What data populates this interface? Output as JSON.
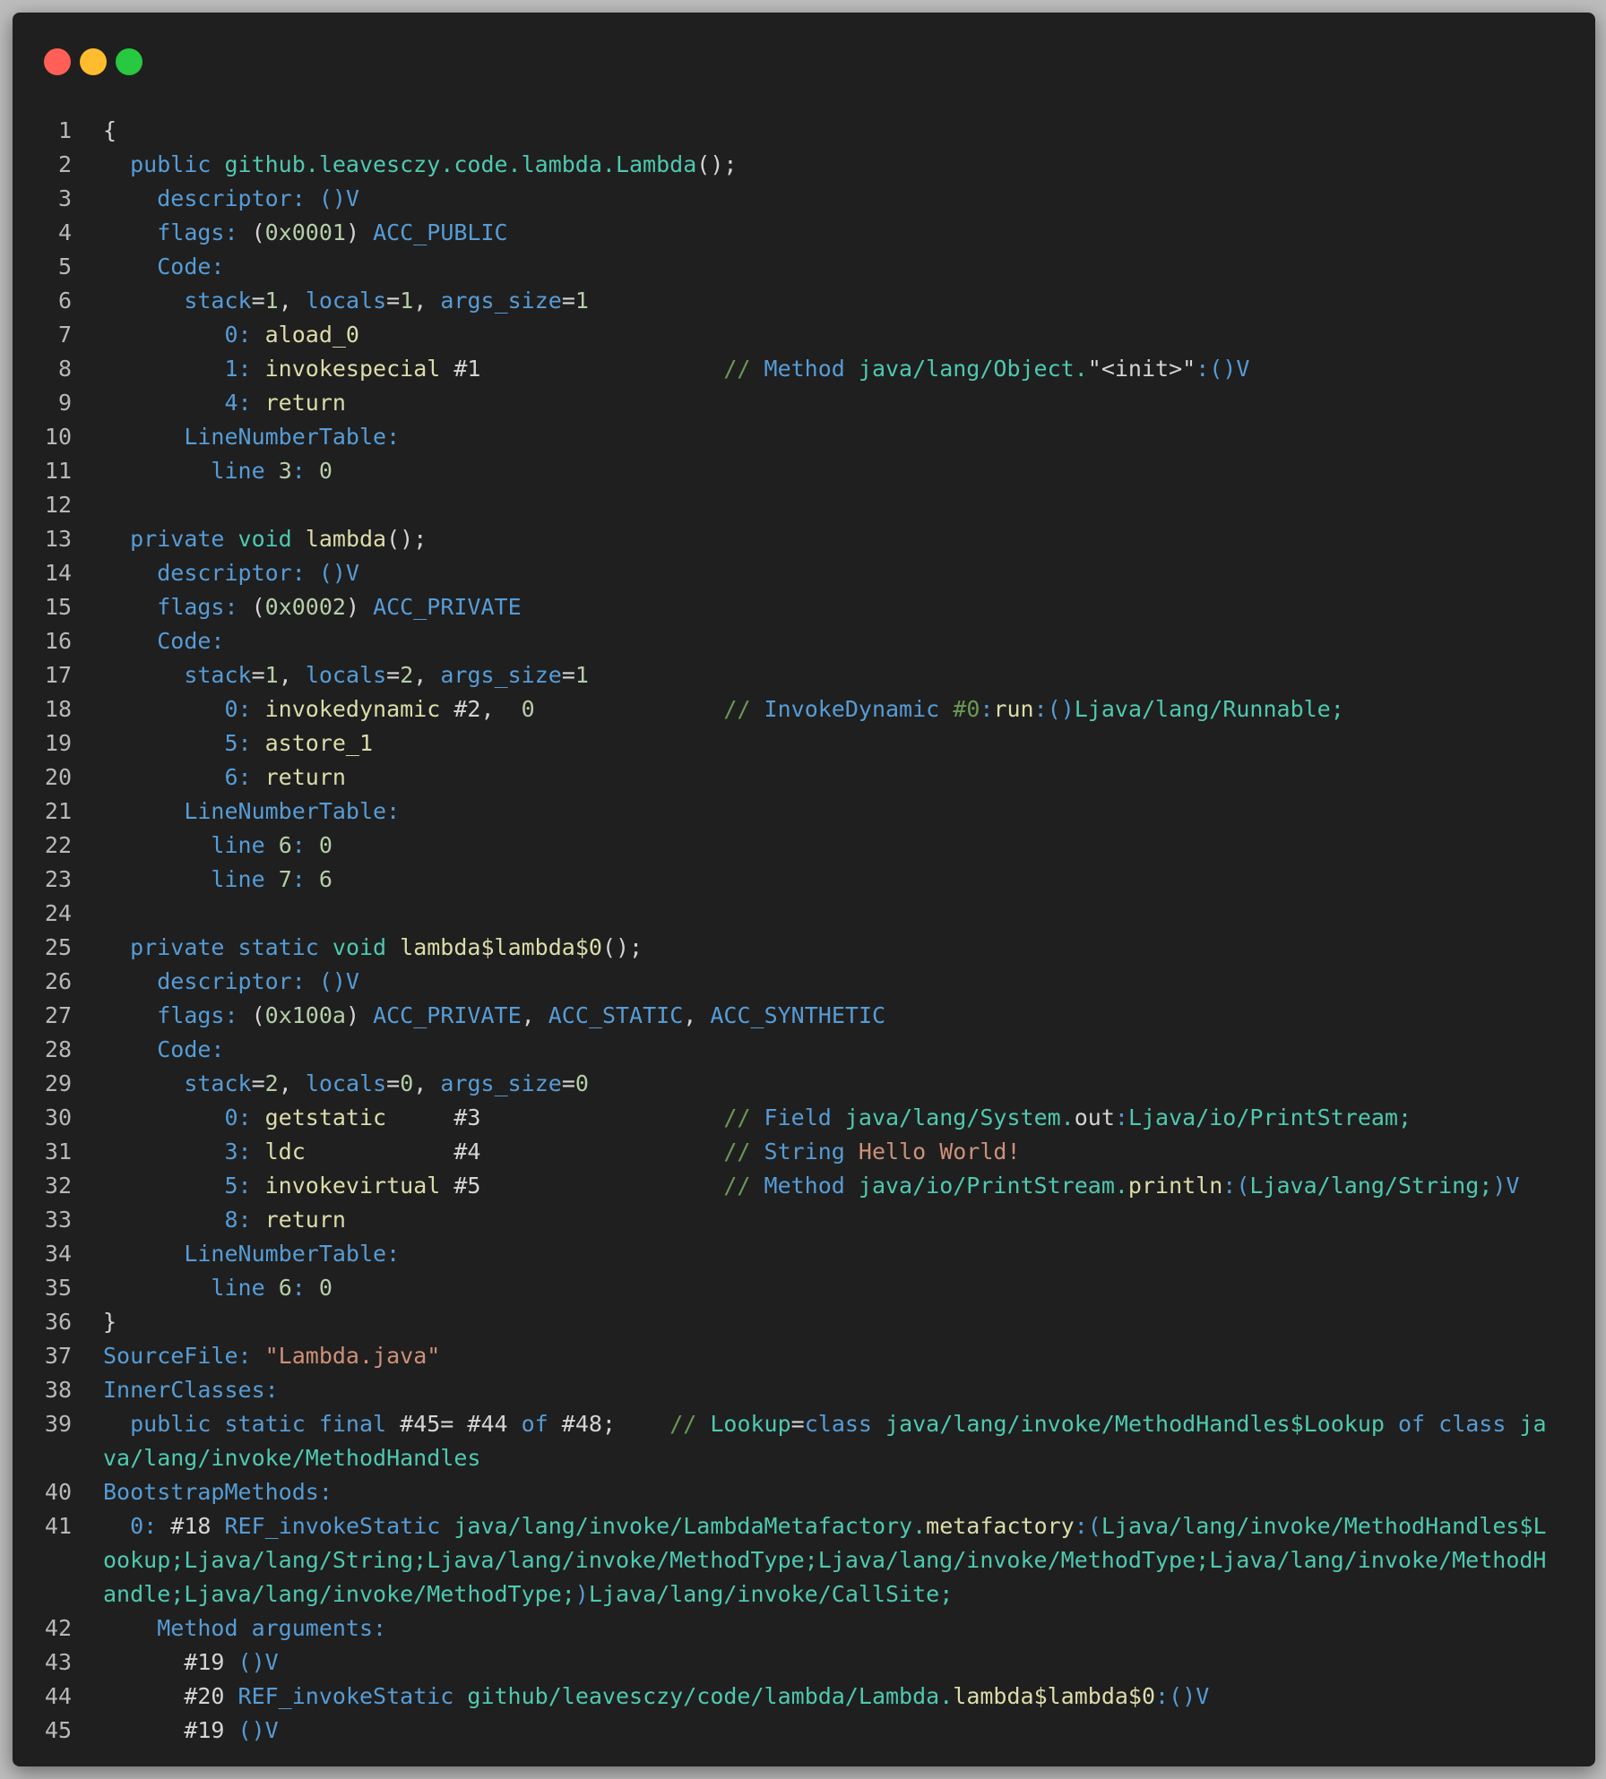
{
  "window": {
    "controls": [
      {
        "name": "close",
        "color": "#ff5f57"
      },
      {
        "name": "minimize",
        "color": "#febc2e"
      },
      {
        "name": "zoom",
        "color": "#28c840"
      }
    ]
  },
  "colors": {
    "background": "#1f1f1f",
    "keyword": "#569cd6",
    "type": "#4ec9b0",
    "number": "#b5cea8",
    "string": "#ce9178",
    "function": "#dcdcaa",
    "comment": "#6a9955",
    "plain": "#d4d4d4"
  },
  "lines": [
    {
      "n": "1",
      "segs": [
        [
          "w",
          "{"
        ]
      ]
    },
    {
      "n": "2",
      "segs": [
        [
          "w",
          "  "
        ],
        [
          "k",
          "public "
        ],
        [
          "t",
          "github.leavesczy.code.lambda.Lambda"
        ],
        [
          "w",
          "();"
        ]
      ]
    },
    {
      "n": "3",
      "segs": [
        [
          "w",
          "    "
        ],
        [
          "k",
          "descriptor: ()V"
        ]
      ]
    },
    {
      "n": "4",
      "segs": [
        [
          "w",
          "    "
        ],
        [
          "k",
          "flags: "
        ],
        [
          "w",
          "("
        ],
        [
          "n",
          "0x0001"
        ],
        [
          "w",
          ") "
        ],
        [
          "k",
          "ACC_PUBLIC"
        ]
      ]
    },
    {
      "n": "5",
      "segs": [
        [
          "w",
          "    "
        ],
        [
          "k",
          "Code:"
        ]
      ]
    },
    {
      "n": "6",
      "segs": [
        [
          "w",
          "      "
        ],
        [
          "k",
          "stack"
        ],
        [
          "w",
          "="
        ],
        [
          "n",
          "1"
        ],
        [
          "w",
          ", "
        ],
        [
          "k",
          "locals"
        ],
        [
          "w",
          "="
        ],
        [
          "n",
          "1"
        ],
        [
          "w",
          ", "
        ],
        [
          "k",
          "args_size"
        ],
        [
          "w",
          "="
        ],
        [
          "n",
          "1"
        ]
      ]
    },
    {
      "n": "7",
      "segs": [
        [
          "w",
          "         "
        ],
        [
          "k",
          "0: "
        ],
        [
          "f",
          "aload_0"
        ]
      ]
    },
    {
      "n": "8",
      "segs": [
        [
          "w",
          "         "
        ],
        [
          "k",
          "1: "
        ],
        [
          "f",
          "invokespecial"
        ],
        [
          "w",
          " #1                  "
        ],
        [
          "c",
          "// "
        ],
        [
          "k",
          "Method "
        ],
        [
          "t",
          "java/lang/Object."
        ],
        [
          "w",
          "\"<init>\""
        ],
        [
          "k",
          ":()V"
        ]
      ]
    },
    {
      "n": "9",
      "segs": [
        [
          "w",
          "         "
        ],
        [
          "k",
          "4: "
        ],
        [
          "f",
          "return"
        ]
      ]
    },
    {
      "n": "10",
      "segs": [
        [
          "w",
          "      "
        ],
        [
          "k",
          "LineNumberTable:"
        ]
      ]
    },
    {
      "n": "11",
      "segs": [
        [
          "w",
          "        "
        ],
        [
          "k",
          "line "
        ],
        [
          "n",
          "3"
        ],
        [
          "k",
          ": "
        ],
        [
          "n",
          "0"
        ]
      ]
    },
    {
      "n": "12",
      "segs": []
    },
    {
      "n": "13",
      "segs": [
        [
          "w",
          "  "
        ],
        [
          "k",
          "private "
        ],
        [
          "t",
          "void "
        ],
        [
          "f",
          "lambda"
        ],
        [
          "w",
          "();"
        ]
      ]
    },
    {
      "n": "14",
      "segs": [
        [
          "w",
          "    "
        ],
        [
          "k",
          "descriptor: ()V"
        ]
      ]
    },
    {
      "n": "15",
      "segs": [
        [
          "w",
          "    "
        ],
        [
          "k",
          "flags: "
        ],
        [
          "w",
          "("
        ],
        [
          "n",
          "0x0002"
        ],
        [
          "w",
          ") "
        ],
        [
          "k",
          "ACC_PRIVATE"
        ]
      ]
    },
    {
      "n": "16",
      "segs": [
        [
          "w",
          "    "
        ],
        [
          "k",
          "Code:"
        ]
      ]
    },
    {
      "n": "17",
      "segs": [
        [
          "w",
          "      "
        ],
        [
          "k",
          "stack"
        ],
        [
          "w",
          "="
        ],
        [
          "n",
          "1"
        ],
        [
          "w",
          ", "
        ],
        [
          "k",
          "locals"
        ],
        [
          "w",
          "="
        ],
        [
          "n",
          "2"
        ],
        [
          "w",
          ", "
        ],
        [
          "k",
          "args_size"
        ],
        [
          "w",
          "="
        ],
        [
          "n",
          "1"
        ]
      ]
    },
    {
      "n": "18",
      "segs": [
        [
          "w",
          "         "
        ],
        [
          "k",
          "0: "
        ],
        [
          "f",
          "invokedynamic"
        ],
        [
          "w",
          " #2,  "
        ],
        [
          "n",
          "0"
        ],
        [
          "w",
          "              "
        ],
        [
          "c",
          "// "
        ],
        [
          "k",
          "InvokeDynamic "
        ],
        [
          "c",
          "#0"
        ],
        [
          "k",
          ":"
        ],
        [
          "f",
          "run"
        ],
        [
          "k",
          ":()"
        ],
        [
          "t",
          "Ljava/lang/Runnable;"
        ]
      ]
    },
    {
      "n": "19",
      "segs": [
        [
          "w",
          "         "
        ],
        [
          "k",
          "5: "
        ],
        [
          "f",
          "astore_1"
        ]
      ]
    },
    {
      "n": "20",
      "segs": [
        [
          "w",
          "         "
        ],
        [
          "k",
          "6: "
        ],
        [
          "f",
          "return"
        ]
      ]
    },
    {
      "n": "21",
      "segs": [
        [
          "w",
          "      "
        ],
        [
          "k",
          "LineNumberTable:"
        ]
      ]
    },
    {
      "n": "22",
      "segs": [
        [
          "w",
          "        "
        ],
        [
          "k",
          "line "
        ],
        [
          "n",
          "6"
        ],
        [
          "k",
          ": "
        ],
        [
          "n",
          "0"
        ]
      ]
    },
    {
      "n": "23",
      "segs": [
        [
          "w",
          "        "
        ],
        [
          "k",
          "line "
        ],
        [
          "n",
          "7"
        ],
        [
          "k",
          ": "
        ],
        [
          "n",
          "6"
        ]
      ]
    },
    {
      "n": "24",
      "segs": []
    },
    {
      "n": "25",
      "segs": [
        [
          "w",
          "  "
        ],
        [
          "k",
          "private static "
        ],
        [
          "t",
          "void "
        ],
        [
          "f",
          "lambda$lambda$0"
        ],
        [
          "w",
          "();"
        ]
      ]
    },
    {
      "n": "26",
      "segs": [
        [
          "w",
          "    "
        ],
        [
          "k",
          "descriptor: ()V"
        ]
      ]
    },
    {
      "n": "27",
      "segs": [
        [
          "w",
          "    "
        ],
        [
          "k",
          "flags: "
        ],
        [
          "w",
          "("
        ],
        [
          "n",
          "0x100a"
        ],
        [
          "w",
          ") "
        ],
        [
          "k",
          "ACC_PRIVATE"
        ],
        [
          "w",
          ", "
        ],
        [
          "k",
          "ACC_STATIC"
        ],
        [
          "w",
          ", "
        ],
        [
          "k",
          "ACC_SYNTHETIC"
        ]
      ]
    },
    {
      "n": "28",
      "segs": [
        [
          "w",
          "    "
        ],
        [
          "k",
          "Code:"
        ]
      ]
    },
    {
      "n": "29",
      "segs": [
        [
          "w",
          "      "
        ],
        [
          "k",
          "stack"
        ],
        [
          "w",
          "="
        ],
        [
          "n",
          "2"
        ],
        [
          "w",
          ", "
        ],
        [
          "k",
          "locals"
        ],
        [
          "w",
          "="
        ],
        [
          "n",
          "0"
        ],
        [
          "w",
          ", "
        ],
        [
          "k",
          "args_size"
        ],
        [
          "w",
          "="
        ],
        [
          "n",
          "0"
        ]
      ]
    },
    {
      "n": "30",
      "segs": [
        [
          "w",
          "         "
        ],
        [
          "k",
          "0: "
        ],
        [
          "f",
          "getstatic"
        ],
        [
          "w",
          "     #3                  "
        ],
        [
          "c",
          "// "
        ],
        [
          "k",
          "Field "
        ],
        [
          "t",
          "java/lang/System."
        ],
        [
          "w",
          "out"
        ],
        [
          "k",
          ":"
        ],
        [
          "t",
          "Ljava/io/PrintStream;"
        ]
      ]
    },
    {
      "n": "31",
      "segs": [
        [
          "w",
          "         "
        ],
        [
          "k",
          "3: "
        ],
        [
          "f",
          "ldc"
        ],
        [
          "w",
          "           #4                  "
        ],
        [
          "c",
          "// "
        ],
        [
          "k",
          "String "
        ],
        [
          "s",
          "Hello World!"
        ]
      ]
    },
    {
      "n": "32",
      "segs": [
        [
          "w",
          "         "
        ],
        [
          "k",
          "5: "
        ],
        [
          "f",
          "invokevirtual"
        ],
        [
          "w",
          " #5                  "
        ],
        [
          "c",
          "// "
        ],
        [
          "k",
          "Method "
        ],
        [
          "t",
          "java/io/PrintStream."
        ],
        [
          "f",
          "println"
        ],
        [
          "k",
          ":("
        ],
        [
          "t",
          "Ljava/lang/String;"
        ],
        [
          "k",
          ")V"
        ]
      ]
    },
    {
      "n": "33",
      "segs": [
        [
          "w",
          "         "
        ],
        [
          "k",
          "8: "
        ],
        [
          "f",
          "return"
        ]
      ]
    },
    {
      "n": "34",
      "segs": [
        [
          "w",
          "      "
        ],
        [
          "k",
          "LineNumberTable:"
        ]
      ]
    },
    {
      "n": "35",
      "segs": [
        [
          "w",
          "        "
        ],
        [
          "k",
          "line "
        ],
        [
          "n",
          "6"
        ],
        [
          "k",
          ": "
        ],
        [
          "n",
          "0"
        ]
      ]
    },
    {
      "n": "36",
      "segs": [
        [
          "w",
          "}"
        ]
      ]
    },
    {
      "n": "37",
      "segs": [
        [
          "k",
          "SourceFile: "
        ],
        [
          "s",
          "\"Lambda.java\""
        ]
      ]
    },
    {
      "n": "38",
      "segs": [
        [
          "k",
          "InnerClasses:"
        ]
      ]
    },
    {
      "n": "39",
      "segs": [
        [
          "w",
          "  "
        ],
        [
          "k",
          "public static final "
        ],
        [
          "w",
          "#45= #44 "
        ],
        [
          "k",
          "of "
        ],
        [
          "w",
          "#48;    "
        ],
        [
          "c",
          "// "
        ],
        [
          "t",
          "Lookup"
        ],
        [
          "w",
          "="
        ],
        [
          "k",
          "class "
        ],
        [
          "t",
          "java/lang/invoke/MethodHandles$Lookup "
        ],
        [
          "k",
          "of class "
        ],
        [
          "t",
          "java/lang/invoke/MethodHandles"
        ]
      ]
    },
    {
      "n": "40",
      "segs": [
        [
          "k",
          "BootstrapMethods:"
        ]
      ]
    },
    {
      "n": "41",
      "segs": [
        [
          "w",
          "  "
        ],
        [
          "k",
          "0: "
        ],
        [
          "w",
          "#18 "
        ],
        [
          "k",
          "REF_invokeStatic "
        ],
        [
          "t",
          "java/lang/invoke/LambdaMetafactory."
        ],
        [
          "f",
          "metafactory"
        ],
        [
          "k",
          ":("
        ],
        [
          "t",
          "Ljava/lang/invoke/MethodHandles$Lookup;Ljava/lang/String;Ljava/lang/invoke/MethodType;Ljava/lang/invoke/MethodType;Ljava/lang/invoke/MethodHandle;Ljava/lang/invoke/MethodType;"
        ],
        [
          "k",
          ")"
        ],
        [
          "t",
          "Ljava/lang/invoke/CallSite;"
        ]
      ]
    },
    {
      "n": "42",
      "segs": [
        [
          "w",
          "    "
        ],
        [
          "k",
          "Method arguments:"
        ]
      ]
    },
    {
      "n": "43",
      "segs": [
        [
          "w",
          "      #19 "
        ],
        [
          "k",
          "()V"
        ]
      ]
    },
    {
      "n": "44",
      "segs": [
        [
          "w",
          "      #20 "
        ],
        [
          "k",
          "REF_invokeStatic "
        ],
        [
          "t",
          "github/leavesczy/code/lambda/Lambda."
        ],
        [
          "f",
          "lambda$lambda$0"
        ],
        [
          "k",
          ":()V"
        ]
      ]
    },
    {
      "n": "45",
      "segs": [
        [
          "w",
          "      #19 "
        ],
        [
          "k",
          "()V"
        ]
      ]
    }
  ]
}
